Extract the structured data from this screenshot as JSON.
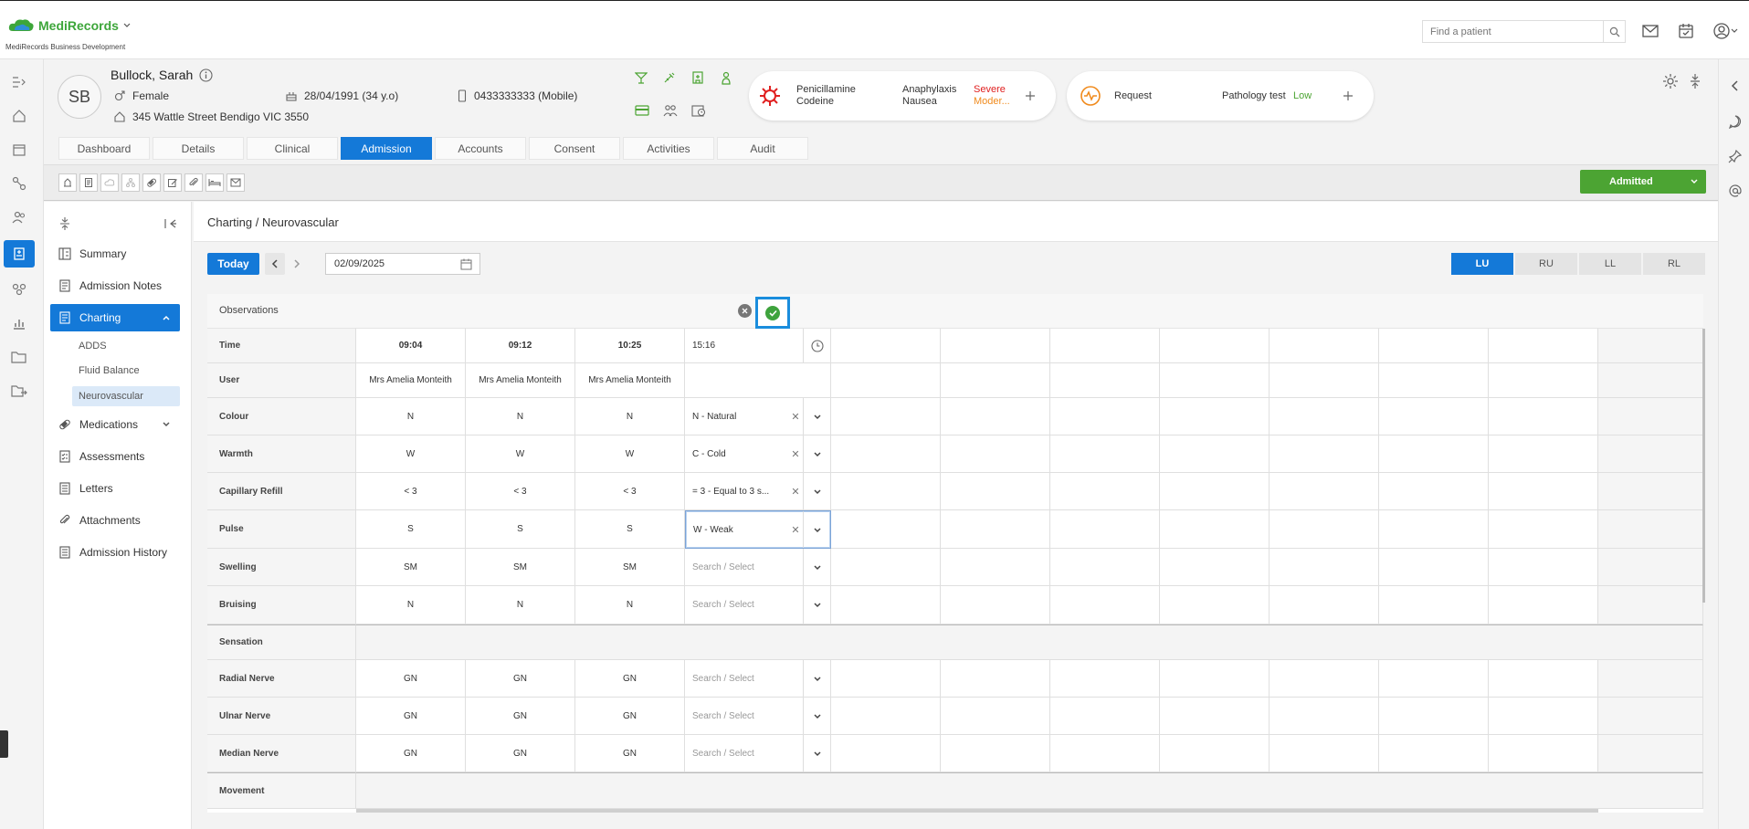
{
  "brand": {
    "name": "MediRecords",
    "subtitle": "MediRecords Business Development"
  },
  "topbar": {
    "search_placeholder": "Find a patient"
  },
  "patient": {
    "initials": "SB",
    "name": "Bullock, Sarah",
    "gender": "Female",
    "dob": "28/04/1991 (34 y.o)",
    "phone": "0433333333 (Mobile)",
    "address": "345 Wattle Street Bendigo VIC 3550"
  },
  "alerts": {
    "allergy1": "Penicillamine",
    "allergy2": "Codeine",
    "reaction1": "Anaphylaxis",
    "reaction2": "Nausea",
    "severity1": "Severe",
    "severity2": "Moder...",
    "severity1_color": "#e02020",
    "severity2_color": "#f08a1c"
  },
  "request": {
    "label": "Request",
    "type": "Pathology test",
    "priority": "Low",
    "priority_color": "#4ca433"
  },
  "tabs": [
    "Dashboard",
    "Details",
    "Clinical",
    "Admission",
    "Accounts",
    "Consent",
    "Activities",
    "Audit"
  ],
  "active_tab": "Admission",
  "status_button": "Admitted",
  "sidebar": {
    "items": [
      {
        "label": "Summary",
        "icon": "summary-icon"
      },
      {
        "label": "Admission Notes",
        "icon": "notes-icon"
      },
      {
        "label": "Charting",
        "icon": "charting-icon"
      },
      {
        "label": "ADDS"
      },
      {
        "label": "Fluid Balance"
      },
      {
        "label": "Neurovascular"
      },
      {
        "label": "Medications",
        "icon": "pill-icon"
      },
      {
        "label": "Assessments",
        "icon": "assessment-icon"
      },
      {
        "label": "Letters",
        "icon": "letter-icon"
      },
      {
        "label": "Attachments",
        "icon": "paperclip-icon"
      },
      {
        "label": "Admission History",
        "icon": "history-icon"
      }
    ]
  },
  "page": {
    "breadcrumb": "Charting / Neurovascular",
    "today_label": "Today",
    "date": "02/09/2025",
    "limbs": [
      "LU",
      "RU",
      "LL",
      "RL"
    ],
    "active_limb": "LU"
  },
  "observations": {
    "title": "Observations",
    "times": [
      "09:04",
      "09:12",
      "10:25"
    ],
    "new_time": "15:16",
    "placeholder": "Search / Select",
    "rows": {
      "time": "Time",
      "user": "User",
      "colour": "Colour",
      "warmth": "Warmth",
      "capillary": "Capillary Refill",
      "pulse": "Pulse",
      "swelling": "Swelling",
      "bruising": "Bruising",
      "sensation": "Sensation",
      "radial": "Radial Nerve",
      "ulnar": "Ulnar Nerve",
      "median": "Median Nerve",
      "movement": "Movement"
    },
    "values": {
      "user": [
        "Mrs Amelia Monteith",
        "Mrs Amelia Monteith",
        "Mrs Amelia Monteith"
      ],
      "colour": [
        "N",
        "N",
        "N"
      ],
      "warmth": [
        "W",
        "W",
        "W"
      ],
      "capillary": [
        "< 3",
        "< 3",
        "< 3"
      ],
      "pulse": [
        "S",
        "S",
        "S"
      ],
      "swelling": [
        "SM",
        "SM",
        "SM"
      ],
      "bruising": [
        "N",
        "N",
        "N"
      ],
      "radial": [
        "GN",
        "GN",
        "GN"
      ],
      "ulnar": [
        "GN",
        "GN",
        "GN"
      ],
      "median": [
        "GN",
        "GN",
        "GN"
      ]
    },
    "new_entry": {
      "colour": "N - Natural",
      "warmth": "C - Cold",
      "capillary": "= 3 - Equal to 3 s...",
      "pulse": "W - Weak"
    }
  }
}
